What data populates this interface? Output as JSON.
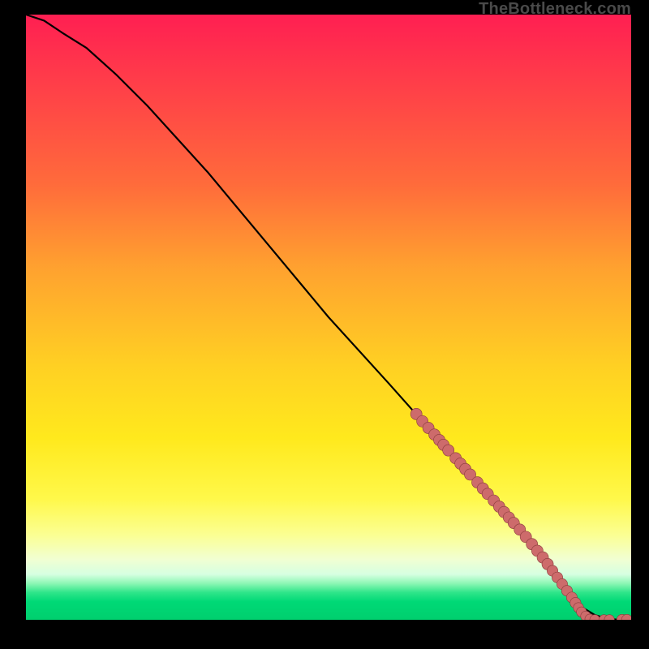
{
  "watermark": "TheBottleneck.com",
  "colors": {
    "frame": "#000000",
    "curve": "#000000",
    "marker_fill": "#cd6b6b",
    "marker_stroke": "#8a3c3c"
  },
  "chart_data": {
    "type": "line",
    "title": "",
    "xlabel": "",
    "ylabel": "",
    "xlim": [
      0,
      100
    ],
    "ylim": [
      0,
      100
    ],
    "grid": false,
    "series": [
      {
        "name": "curve",
        "x": [
          0,
          3,
          6,
          10,
          15,
          20,
          30,
          40,
          50,
          60,
          68,
          76,
          82,
          86,
          88,
          90,
          92,
          94,
          96,
          98,
          100
        ],
        "y": [
          100,
          99,
          97,
          94.5,
          90,
          85,
          74,
          62,
          50,
          39,
          30,
          21,
          14,
          9,
          6.5,
          4,
          2,
          0.8,
          0.2,
          0,
          0
        ]
      }
    ],
    "markers": [
      {
        "x": 64.5,
        "y": 34,
        "r": 0.9
      },
      {
        "x": 65.5,
        "y": 32.8,
        "r": 0.9
      },
      {
        "x": 66.5,
        "y": 31.7,
        "r": 0.9
      },
      {
        "x": 67.5,
        "y": 30.6,
        "r": 0.9
      },
      {
        "x": 68.3,
        "y": 29.7,
        "r": 0.9
      },
      {
        "x": 69.0,
        "y": 28.9,
        "r": 0.9
      },
      {
        "x": 69.8,
        "y": 28.0,
        "r": 0.9
      },
      {
        "x": 71.0,
        "y": 26.7,
        "r": 0.9
      },
      {
        "x": 71.8,
        "y": 25.8,
        "r": 0.9
      },
      {
        "x": 72.6,
        "y": 24.9,
        "r": 0.9
      },
      {
        "x": 73.4,
        "y": 24.0,
        "r": 0.9
      },
      {
        "x": 74.6,
        "y": 22.7,
        "r": 0.9
      },
      {
        "x": 75.5,
        "y": 21.7,
        "r": 0.9
      },
      {
        "x": 76.3,
        "y": 20.8,
        "r": 0.9
      },
      {
        "x": 77.3,
        "y": 19.7,
        "r": 0.9
      },
      {
        "x": 78.2,
        "y": 18.7,
        "r": 0.9
      },
      {
        "x": 79.0,
        "y": 17.8,
        "r": 0.9
      },
      {
        "x": 79.8,
        "y": 16.9,
        "r": 0.9
      },
      {
        "x": 80.6,
        "y": 16.0,
        "r": 0.9
      },
      {
        "x": 81.6,
        "y": 14.9,
        "r": 0.9
      },
      {
        "x": 82.6,
        "y": 13.7,
        "r": 0.9
      },
      {
        "x": 83.6,
        "y": 12.5,
        "r": 0.9
      },
      {
        "x": 84.5,
        "y": 11.4,
        "r": 0.9
      },
      {
        "x": 85.4,
        "y": 10.3,
        "r": 0.9
      },
      {
        "x": 86.2,
        "y": 9.2,
        "r": 0.9
      },
      {
        "x": 87.0,
        "y": 8.1,
        "r": 0.85
      },
      {
        "x": 87.8,
        "y": 7.0,
        "r": 0.85
      },
      {
        "x": 88.6,
        "y": 5.9,
        "r": 0.85
      },
      {
        "x": 89.4,
        "y": 4.8,
        "r": 0.85
      },
      {
        "x": 90.2,
        "y": 3.7,
        "r": 0.85
      },
      {
        "x": 90.8,
        "y": 2.8,
        "r": 0.85
      },
      {
        "x": 91.3,
        "y": 2.0,
        "r": 0.8
      },
      {
        "x": 91.8,
        "y": 1.3,
        "r": 0.8
      },
      {
        "x": 92.5,
        "y": 0.6,
        "r": 0.8
      },
      {
        "x": 93.2,
        "y": 0.1,
        "r": 0.8
      },
      {
        "x": 94.0,
        "y": 0.0,
        "r": 0.8
      },
      {
        "x": 95.5,
        "y": 0.0,
        "r": 0.8
      },
      {
        "x": 96.4,
        "y": 0.0,
        "r": 0.8
      },
      {
        "x": 98.5,
        "y": 0.0,
        "r": 0.85
      },
      {
        "x": 99.3,
        "y": 0.0,
        "r": 0.85
      }
    ]
  }
}
